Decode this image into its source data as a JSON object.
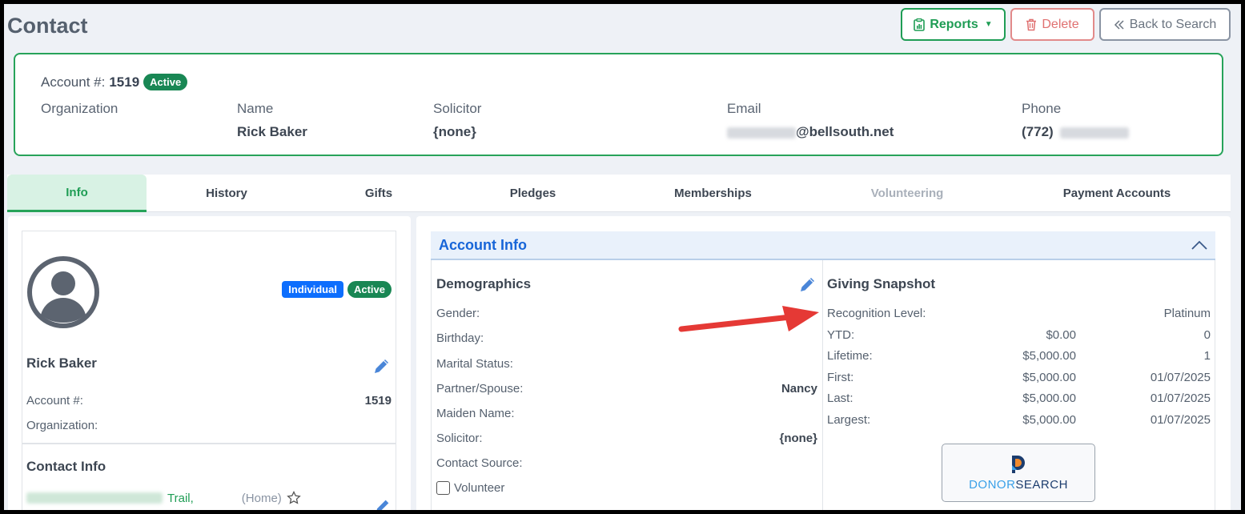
{
  "page": {
    "title": "Contact"
  },
  "actions": {
    "reports_label": "Reports",
    "delete_label": "Delete",
    "back_label": "Back to Search"
  },
  "summary": {
    "account_label": "Account #:",
    "account_number": "1519",
    "status": "Active",
    "organization_label": "Organization",
    "organization_value": "",
    "name_label": "Name",
    "name_value": "Rick Baker",
    "solicitor_label": "Solicitor",
    "solicitor_value": "{none}",
    "email_label": "Email",
    "email_domain": "@bellsouth.net",
    "phone_label": "Phone",
    "phone_area": "(772)"
  },
  "tabs": [
    {
      "label": "Info",
      "state": "active"
    },
    {
      "label": "History",
      "state": "normal"
    },
    {
      "label": "Gifts",
      "state": "normal"
    },
    {
      "label": "Pledges",
      "state": "normal"
    },
    {
      "label": "Memberships",
      "state": "normal"
    },
    {
      "label": "Volunteering",
      "state": "disabled"
    },
    {
      "label": "Payment Accounts",
      "state": "normal"
    }
  ],
  "profile": {
    "type_badge": "Individual",
    "status_badge": "Active",
    "name": "Rick Baker",
    "account_label": "Account #:",
    "account_value": "1519",
    "organization_label": "Organization:"
  },
  "contact_info": {
    "title": "Contact Info",
    "address_suffix": "Trail,",
    "address_type": "(Home)"
  },
  "account_info": {
    "title": "Account Info",
    "demographics": {
      "title": "Demographics",
      "rows": [
        {
          "label": "Gender:",
          "value": ""
        },
        {
          "label": "Birthday:",
          "value": ""
        },
        {
          "label": "Marital Status:",
          "value": ""
        },
        {
          "label": "Partner/Spouse:",
          "value": "Nancy"
        },
        {
          "label": "Maiden Name:",
          "value": ""
        },
        {
          "label": "Solicitor:",
          "value": "{none}"
        },
        {
          "label": "Contact Source:",
          "value": ""
        }
      ],
      "volunteer_label": "Volunteer"
    },
    "giving": {
      "title": "Giving Snapshot",
      "recognition_label": "Recognition Level:",
      "recognition_value": "Platinum",
      "rows": [
        {
          "label": "YTD:",
          "amount": "$0.00",
          "extra": "0"
        },
        {
          "label": "Lifetime:",
          "amount": "$5,000.00",
          "extra": "1"
        },
        {
          "label": "First:",
          "amount": "$5,000.00",
          "extra": "01/07/2025"
        },
        {
          "label": "Last:",
          "amount": "$5,000.00",
          "extra": "01/07/2025"
        },
        {
          "label": "Largest:",
          "amount": "$5,000.00",
          "extra": "01/07/2025"
        }
      ],
      "donorsearch": {
        "part1": "DONOR",
        "part2": "SEARCH"
      }
    }
  },
  "colors": {
    "accent_green": "#1f9d55",
    "accent_blue": "#1765d8",
    "danger": "#e07070",
    "annotation_arrow": "#e53935"
  }
}
